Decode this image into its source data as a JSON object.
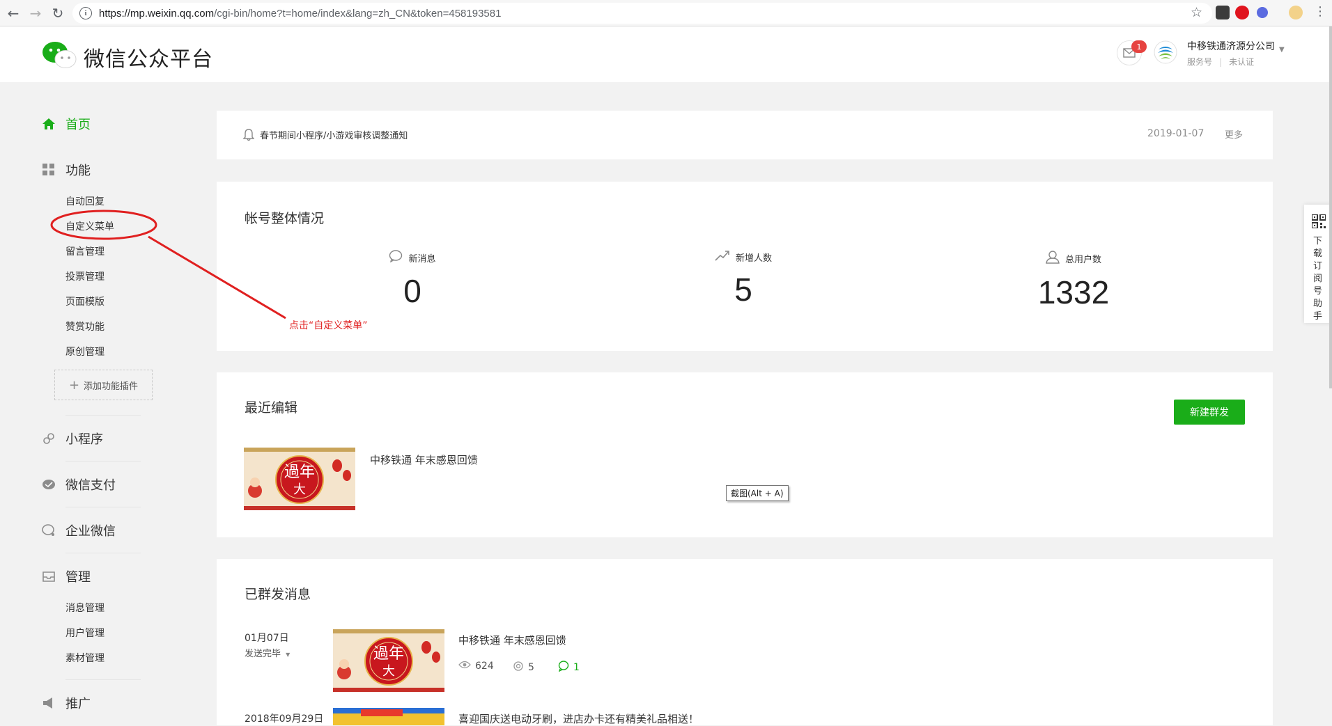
{
  "browser": {
    "url_host": "https://mp.weixin.qq.com",
    "url_path": "/cgi-bin/home?t=home/index&lang=zh_CN&token=458193581"
  },
  "header": {
    "brand": "微信公众平台",
    "message_badge": "1",
    "account_name": "中移铁通济源分公司",
    "account_type": "服务号",
    "account_verify": "未认证"
  },
  "sidebar": {
    "home": "首页",
    "features": "功能",
    "feature_items": [
      "自动回复",
      "自定义菜单",
      "留言管理",
      "投票管理",
      "页面模版",
      "赞赏功能",
      "原创管理"
    ],
    "add_plugin": "添加功能插件",
    "mini_program": "小程序",
    "wechat_pay": "微信支付",
    "work_wechat": "企业微信",
    "management": "管理",
    "management_items": [
      "消息管理",
      "用户管理",
      "素材管理"
    ],
    "promotion": "推广"
  },
  "annotation": {
    "text": "点击“自定义菜单”",
    "color": "#e02020"
  },
  "notice": {
    "text": "春节期间小程序/小游戏审核调整通知",
    "date": "2019-01-07",
    "more": "更多"
  },
  "overview": {
    "title": "帐号整体情况",
    "stats": [
      {
        "label": "新消息",
        "value": "0",
        "icon": "chat-bubble-icon"
      },
      {
        "label": "新增人数",
        "value": "5",
        "icon": "trend-up-icon"
      },
      {
        "label": "总用户数",
        "value": "1332",
        "icon": "user-icon"
      }
    ]
  },
  "recent": {
    "title": "最近编辑",
    "new_button": "新建群发",
    "article_title": "中移铁通 年末感恩回馈",
    "tooltip": "截图(Alt + A)"
  },
  "sent": {
    "title": "已群发消息",
    "items": [
      {
        "date": "01月07日",
        "status": "发送完毕",
        "title": "中移铁通 年末感恩回馈",
        "views": "624",
        "likes": "5",
        "comments": "1"
      },
      {
        "date": "2018年09月29日",
        "title": "喜迎国庆送电动牙刷，进店办卡还有精美礼品相送！"
      }
    ]
  },
  "side_panel": {
    "text": "下载订阅号助手"
  },
  "colors": {
    "accent": "#1aad19",
    "badge": "#e64340",
    "annotation": "#e02020"
  }
}
